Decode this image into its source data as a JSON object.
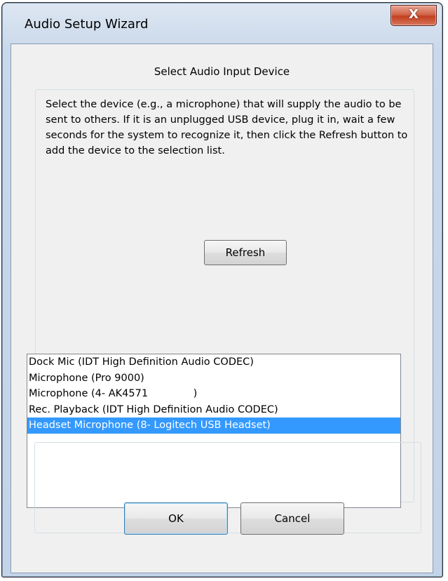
{
  "window": {
    "title": "Audio Setup Wizard",
    "close_icon": "close-icon",
    "close_glyph": "X"
  },
  "main": {
    "heading": "Select Audio Input Device",
    "description": "Select the device (e.g., a microphone) that will supply the audio to be sent to others.  If it is an unplugged USB device, plug it in, wait a few seconds for the system to recognize it, then click the Refresh button to add the device to the selection list.",
    "refresh_label": "Refresh",
    "devices": [
      "Dock Mic (IDT High Definition Audio CODEC)",
      "Microphone (Pro 9000)",
      "Microphone (4- AK4571              )",
      "Rec. Playback (IDT High Definition Audio CODEC)",
      "Headset Microphone (8- Logitech USB Headset)"
    ],
    "selected_device": "Headset Microphone (8- Logitech USB Headset)"
  },
  "footer": {
    "ok_label": "OK",
    "cancel_label": "Cancel"
  },
  "colors": {
    "selection": "#3399ff",
    "close_button": "#c2401f"
  }
}
